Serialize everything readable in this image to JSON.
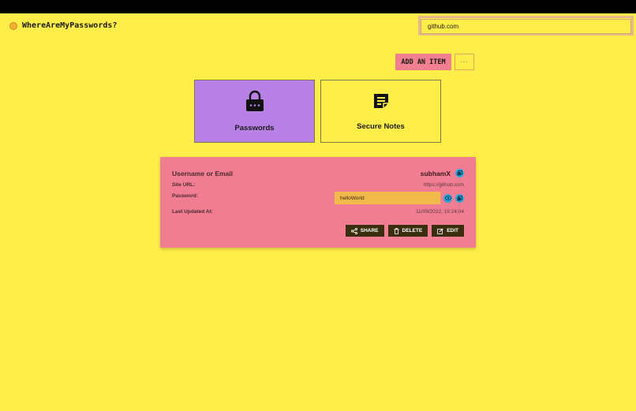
{
  "app": {
    "title": "WhereAreMyPasswords?"
  },
  "search": {
    "value": "github.com",
    "placeholder": ""
  },
  "toolbar": {
    "add_label": "ADD AN ITEM",
    "more_label": "···"
  },
  "categories": [
    {
      "label": "Passwords",
      "icon": "lock-icon",
      "color": "#b881e6"
    },
    {
      "label": "Secure Notes",
      "icon": "note-icon",
      "color": "#ffee4a"
    }
  ],
  "entry": {
    "username_label": "Username or Email",
    "username_value": "subhamX",
    "site_label": "Site URL:",
    "site_value": "https://github.com",
    "password_label": "Password:",
    "password_value": "helloWorld",
    "updated_label": "Last Updated At:",
    "updated_value": "11/09/2022, 19:24:04",
    "actions": {
      "share": "SHARE",
      "delete": "DELETE",
      "edit": "EDIT"
    }
  },
  "colors": {
    "background": "#ffee4a",
    "accent_pink": "#f07d92",
    "accent_purple": "#b881e6",
    "icon_blue": "#2aa7d8",
    "button_dark": "#3a2e0f"
  }
}
